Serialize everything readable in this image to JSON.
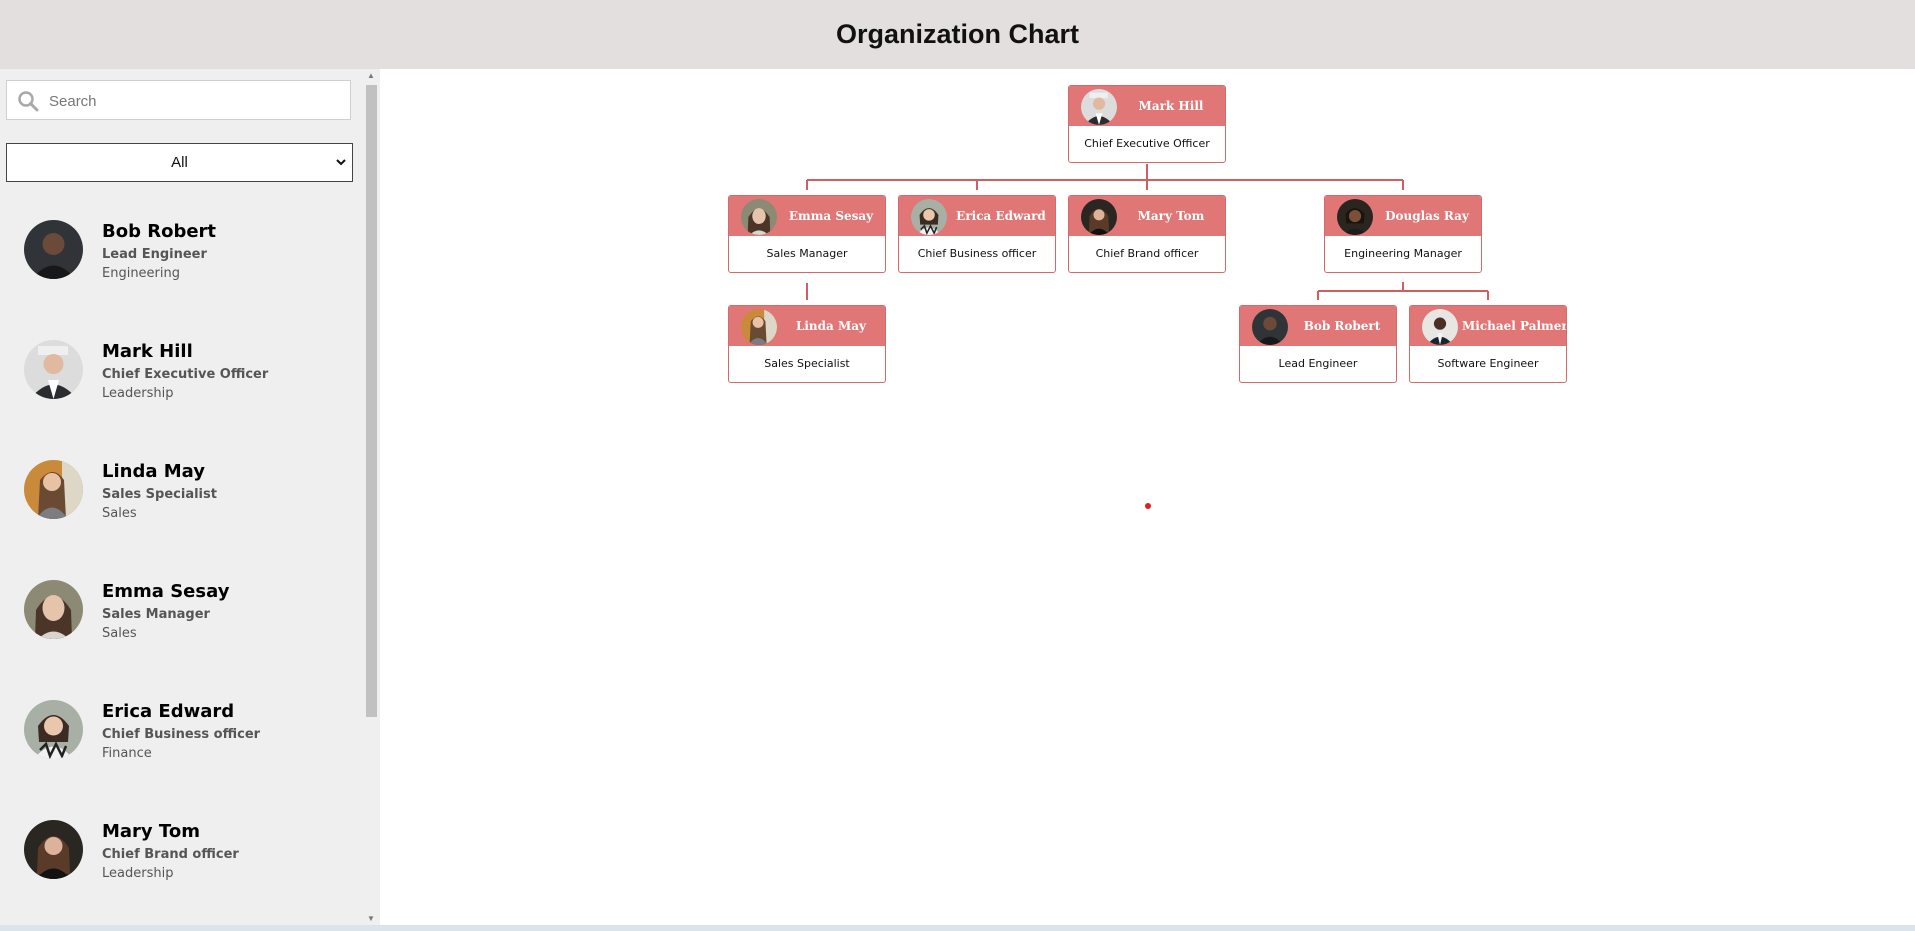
{
  "header": {
    "title": "Organization Chart"
  },
  "search": {
    "placeholder": "Search"
  },
  "filter": {
    "selected": "All"
  },
  "employees": [
    {
      "name": "Bob Robert",
      "role": "Lead Engineer",
      "department": "Engineering"
    },
    {
      "name": "Mark Hill",
      "role": "Chief Executive Officer",
      "department": "Leadership"
    },
    {
      "name": "Linda May",
      "role": "Sales Specialist",
      "department": "Sales"
    },
    {
      "name": "Emma Sesay",
      "role": "Sales Manager",
      "department": "Sales"
    },
    {
      "name": "Erica Edward",
      "role": "Chief Business officer",
      "department": "Finance"
    },
    {
      "name": "Mary Tom",
      "role": "Chief Brand officer",
      "department": "Leadership"
    }
  ],
  "org": {
    "ceo": {
      "name": "Mark Hill",
      "title": "Chief Executive Officer"
    },
    "emma": {
      "name": "Emma Sesay",
      "title": "Sales Manager"
    },
    "erica": {
      "name": "Erica Edward",
      "title": "Chief Business officer"
    },
    "mary": {
      "name": "Mary Tom",
      "title": "Chief Brand officer"
    },
    "douglas": {
      "name": "Douglas Ray",
      "title": "Engineering Manager"
    },
    "linda": {
      "name": "Linda May",
      "title": "Sales Specialist"
    },
    "bob": {
      "name": "Bob Robert",
      "title": "Lead Engineer"
    },
    "michael": {
      "name": "Michael Palmer",
      "title": "Software Engineer"
    }
  },
  "colors": {
    "node_header": "#e07676",
    "node_border": "#d46a6a",
    "connector": "#d06060",
    "header_bg": "#e3dfdf"
  }
}
